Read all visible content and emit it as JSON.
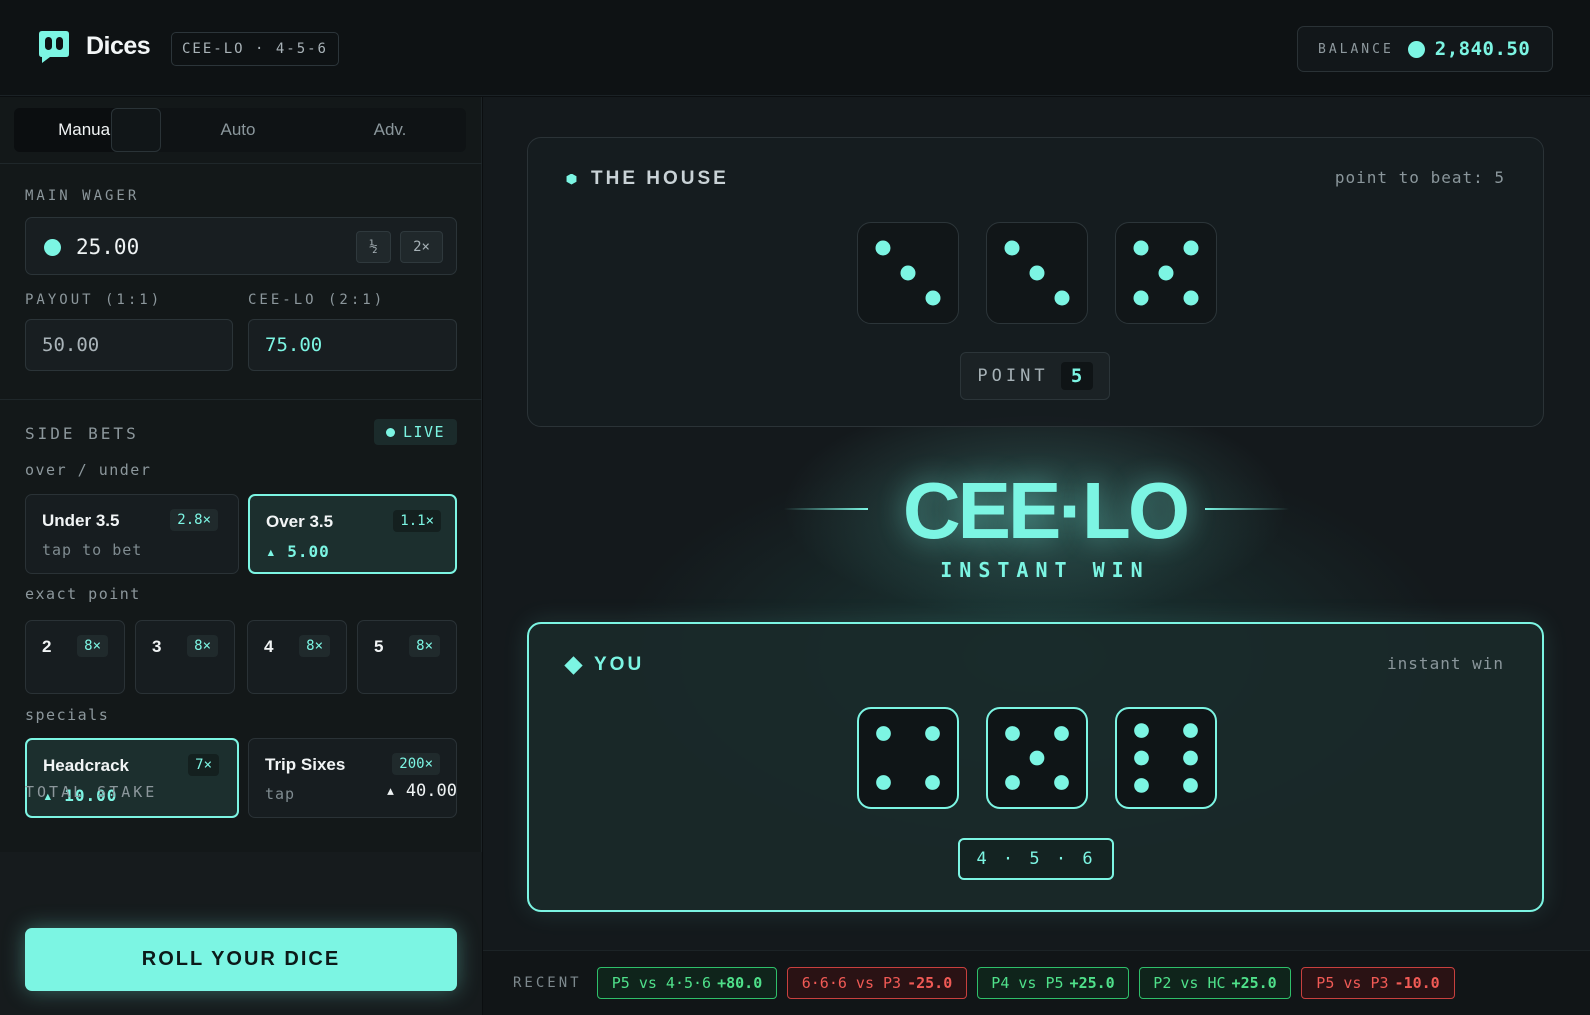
{
  "header": {
    "brand": "Dices",
    "mode": "CEE-LO · 4-5-6",
    "balance_label": "BALANCE",
    "balance_value": "2,840.50"
  },
  "tabs": [
    {
      "label": "Manual",
      "active": true
    },
    {
      "label": "Auto",
      "active": false
    },
    {
      "label": "Adv.",
      "active": false
    }
  ],
  "wager": {
    "label": "MAIN WAGER",
    "value": "25.00",
    "half_label": "½",
    "double_label": "2×",
    "payout_label": "PAYOUT (1:1)",
    "payout_value": "50.00",
    "ceelo_label": "CEE-LO (2:1)",
    "ceelo_value": "75.00"
  },
  "side_bets": {
    "label": "SIDE BETS",
    "live_label": "LIVE",
    "over_under_label": "over / under",
    "over_under": [
      {
        "title": "Under 3.5",
        "mult": "2.8×",
        "sub": "tap to bet",
        "selected": false
      },
      {
        "title": "Over 3.5",
        "mult": "1.1×",
        "sub": "▴ 5.00",
        "selected": true
      }
    ],
    "exact_point_label": "exact point",
    "exact_points": [
      {
        "title": "2",
        "mult": "8×"
      },
      {
        "title": "3",
        "mult": "8×"
      },
      {
        "title": "4",
        "mult": "8×"
      },
      {
        "title": "5",
        "mult": "8×"
      }
    ],
    "specials_label": "specials",
    "specials": [
      {
        "title": "Headcrack",
        "mult": "7×",
        "sub": "▴ 10.00",
        "selected": true
      },
      {
        "title": "Trip Sixes",
        "mult": "200×",
        "sub": "tap",
        "selected": false
      }
    ]
  },
  "stake": {
    "label": "TOTAL STAKE",
    "value": "▴ 40.00",
    "roll_label": "ROLL YOUR DICE"
  },
  "house": {
    "title": "THE HOUSE",
    "note": "point to beat: 5",
    "dice": [
      3,
      3,
      5
    ],
    "point_label": "POINT",
    "point_value": "5"
  },
  "result": {
    "title": "CEE·LO",
    "subtitle": "INSTANT WIN"
  },
  "you": {
    "title": "YOU",
    "note": "instant win",
    "dice": [
      4,
      5,
      6
    ],
    "combo": "4 · 5 · 6"
  },
  "recent": {
    "label": "RECENT",
    "items": [
      {
        "text": "P5 vs 4·5·6",
        "amount": "+80.0",
        "outcome": "win"
      },
      {
        "text": "6·6·6 vs P3",
        "amount": "-25.0",
        "outcome": "loss"
      },
      {
        "text": "P4 vs P5",
        "amount": "+25.0",
        "outcome": "win"
      },
      {
        "text": "P2 vs HC",
        "amount": "+25.0",
        "outcome": "win"
      },
      {
        "text": "P5 vs P3",
        "amount": "-10.0",
        "outcome": "loss"
      }
    ]
  },
  "colors": {
    "accent": "#7cf5e3",
    "win": "#4fe08a",
    "loss": "#f05a55",
    "background": "#0b0e10"
  }
}
